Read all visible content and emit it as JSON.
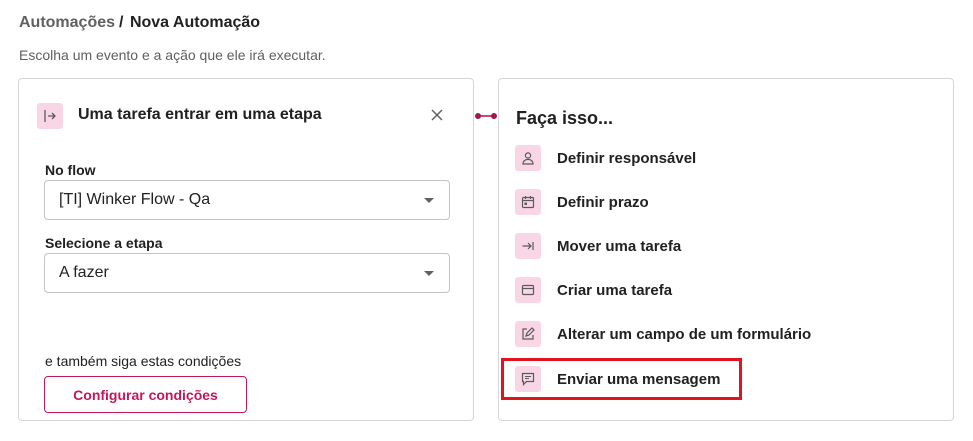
{
  "breadcrumb": {
    "parent": "Automações",
    "separator": "/",
    "current": "Nova Automação"
  },
  "subtitle": "Escolha um evento e a ação que ele irá executar.",
  "trigger": {
    "icon": "enter-stage-icon",
    "title": "Uma tarefa entrar em uma etapa",
    "flow_label": "No flow",
    "flow_value": "[TI] Winker Flow - Qa",
    "stage_label": "Selecione a etapa",
    "stage_value": "A fazer",
    "conditions_text": "e também siga estas condições",
    "conditions_button": "Configurar condições"
  },
  "actions": {
    "title": "Faça isso...",
    "items": [
      {
        "label": "Definir responsável",
        "icon": "person-icon"
      },
      {
        "label": "Definir prazo",
        "icon": "calendar-icon"
      },
      {
        "label": "Mover uma tarefa",
        "icon": "move-arrow-icon"
      },
      {
        "label": "Criar uma tarefa",
        "icon": "card-icon"
      },
      {
        "label": "Alterar um campo de um formulário",
        "icon": "edit-icon"
      },
      {
        "label": "Enviar uma mensagem",
        "icon": "message-icon"
      }
    ]
  },
  "colors": {
    "accent": "#c2185b",
    "icon_bg": "#f9d6e6",
    "highlight": "#e0131f"
  }
}
